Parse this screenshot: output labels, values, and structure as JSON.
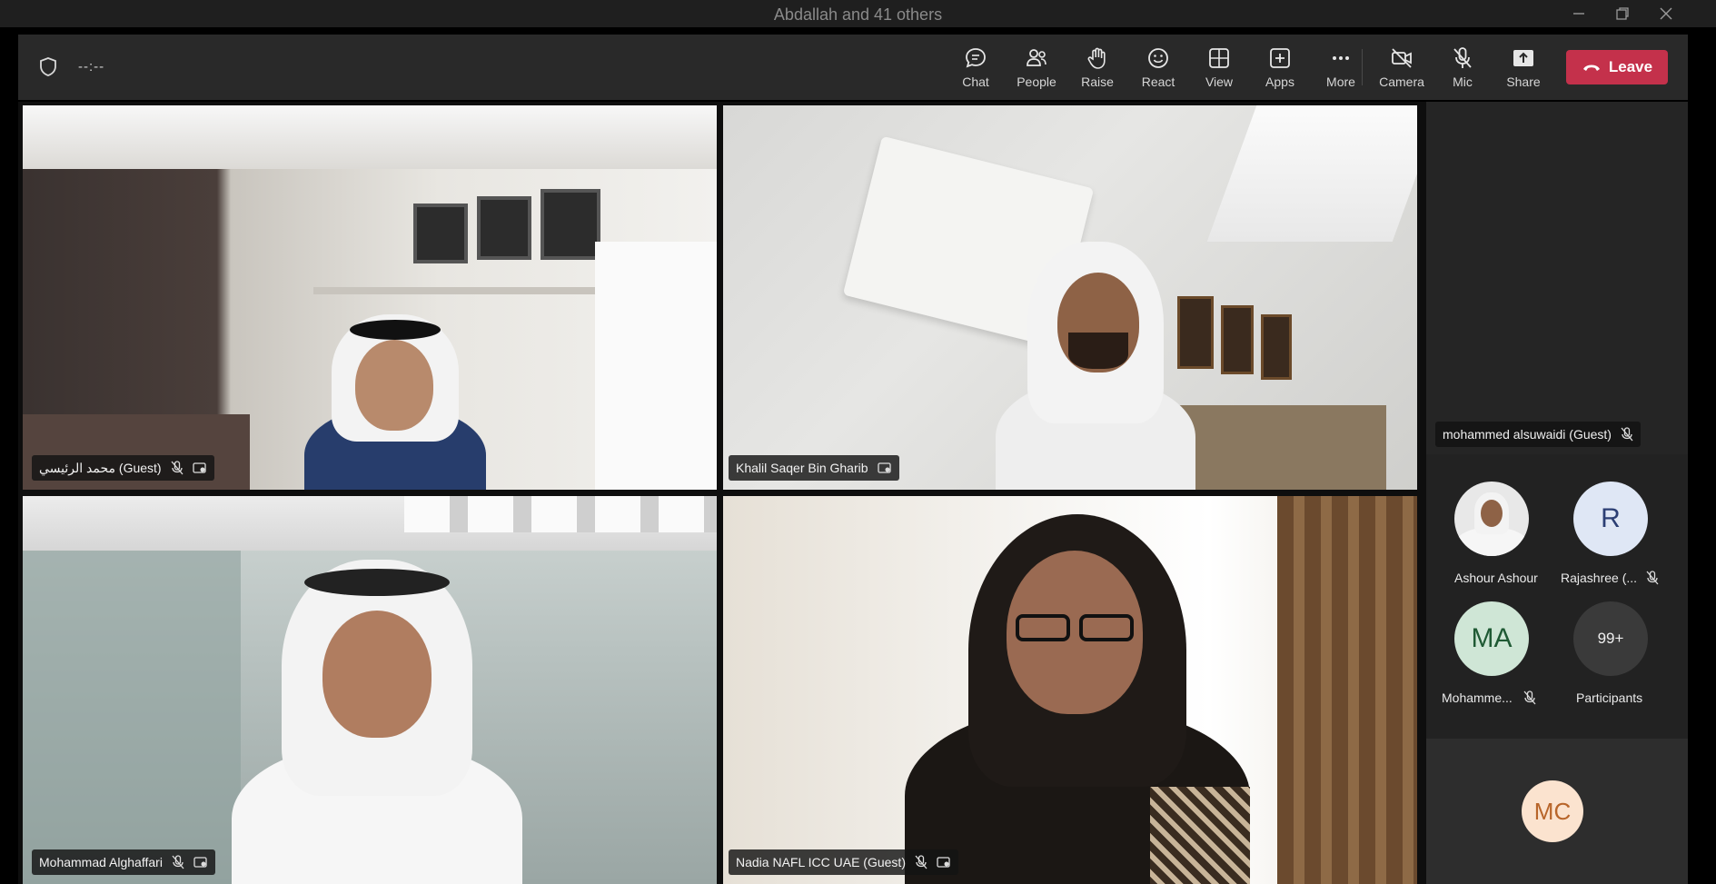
{
  "window": {
    "title": "Abdallah and 41 others"
  },
  "toolbar": {
    "timer": "--:--",
    "buttons": [
      {
        "label": "Chat",
        "icon": "chat-icon"
      },
      {
        "label": "People",
        "icon": "people-icon"
      },
      {
        "label": "Raise",
        "icon": "raise-hand-icon"
      },
      {
        "label": "React",
        "icon": "react-icon"
      },
      {
        "label": "View",
        "icon": "view-icon"
      },
      {
        "label": "Apps",
        "icon": "apps-icon"
      },
      {
        "label": "More",
        "icon": "more-icon"
      },
      {
        "label": "Camera",
        "icon": "camera-off-icon"
      },
      {
        "label": "Mic",
        "icon": "mic-off-icon"
      },
      {
        "label": "Share",
        "icon": "share-icon"
      }
    ],
    "leave_label": "Leave"
  },
  "tiles": [
    {
      "name": "محمد الرئيسي (Guest)"
    },
    {
      "name": "Khalil Saqer Bin Gharib"
    },
    {
      "name": "Mohammad Alghaffari"
    },
    {
      "name": "Nadia NAFL ICC UAE (Guest)"
    }
  ],
  "sidebar": {
    "spotlight_name": "mohammed alsuwaidi (Guest)",
    "attendees": [
      {
        "name": "Ashour Ashour",
        "initials": ""
      },
      {
        "name": "Rajashree (...",
        "initials": "R"
      },
      {
        "name": "Mohamme...",
        "initials": "MA"
      },
      {
        "name": "Participants",
        "initials": "99+"
      }
    ],
    "bottom_initials": "MC"
  },
  "colors": {
    "leave": "#c4314b",
    "active_border": "#7f85f5",
    "toolbar_bg": "#292929"
  }
}
